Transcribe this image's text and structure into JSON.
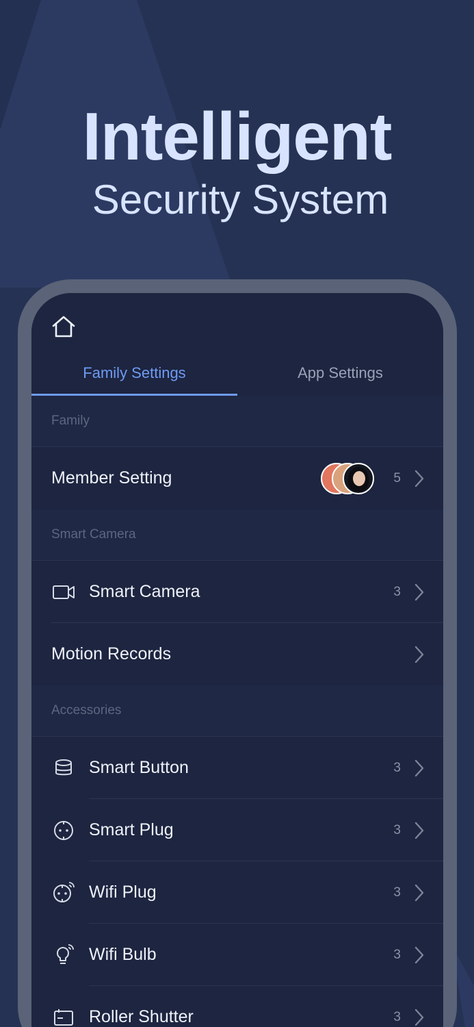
{
  "hero": {
    "title": "Intelligent",
    "subtitle": "Security System"
  },
  "icons": {
    "home": "home-icon",
    "camera": "video-camera-icon",
    "button": "smart-button-icon",
    "plug": "plug-icon",
    "wifi_plug": "wifi-plug-icon",
    "bulb": "wifi-bulb-icon",
    "shutter": "roller-shutter-icon",
    "chevron": "chevron-right-icon"
  },
  "colors": {
    "background": "#263253",
    "accent": "#6f9bf4",
    "screen": "#1d2540"
  },
  "tabs": [
    {
      "label": "Family Settings",
      "active": true
    },
    {
      "label": "App Settings",
      "active": false
    }
  ],
  "sections": {
    "family": {
      "header": "Family",
      "member_setting": {
        "label": "Member Setting",
        "count": "5"
      }
    },
    "smart_camera": {
      "header": "Smart Camera",
      "items": [
        {
          "label": "Smart Camera",
          "count": "3"
        },
        {
          "label": "Motion Records"
        }
      ]
    },
    "accessories": {
      "header": "Accessories",
      "items": [
        {
          "label": "Smart Button",
          "count": "3"
        },
        {
          "label": "Smart Plug",
          "count": "3"
        },
        {
          "label": "Wifi Plug",
          "count": "3"
        },
        {
          "label": "Wifi Bulb",
          "count": "3"
        },
        {
          "label": "Roller Shutter",
          "count": "3"
        }
      ]
    }
  }
}
